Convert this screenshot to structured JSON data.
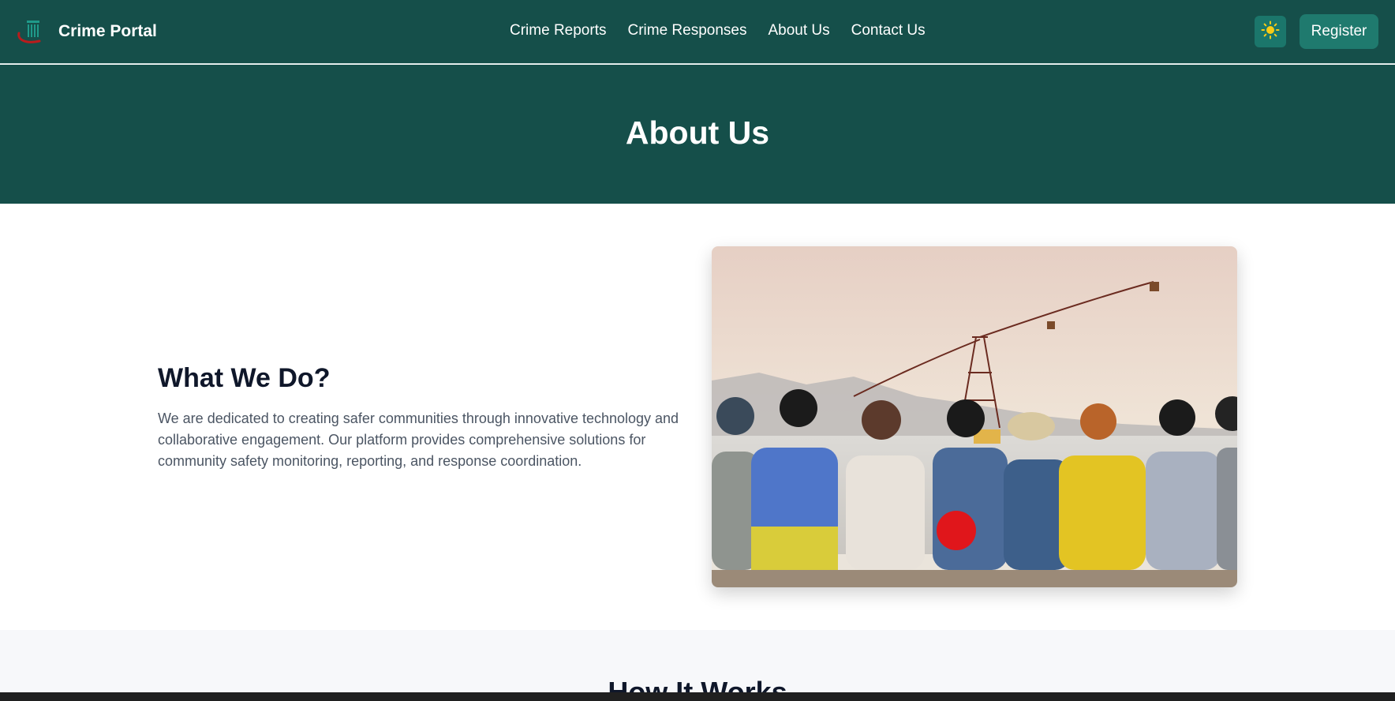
{
  "header": {
    "brand_name": "Crime Portal",
    "nav": [
      {
        "label": "Crime Reports"
      },
      {
        "label": "Crime Responses"
      },
      {
        "label": "About Us"
      },
      {
        "label": "Contact Us"
      }
    ],
    "theme_icon": "sun-icon",
    "register_label": "Register"
  },
  "hero": {
    "title": "About Us"
  },
  "what_we_do": {
    "title": "What We Do?",
    "text": "We are dedicated to creating safer communities through innovative technology and collaborative engagement. Our platform provides comprehensive solutions for community safety monitoring, reporting, and response coordination.",
    "image_icon": "group-photo"
  },
  "how_it_works": {
    "title": "How It Works"
  },
  "colors": {
    "primary": "#154f4a",
    "accent": "#1f7a6e",
    "sun": "#facc15",
    "logo_red": "#b91c1c"
  }
}
